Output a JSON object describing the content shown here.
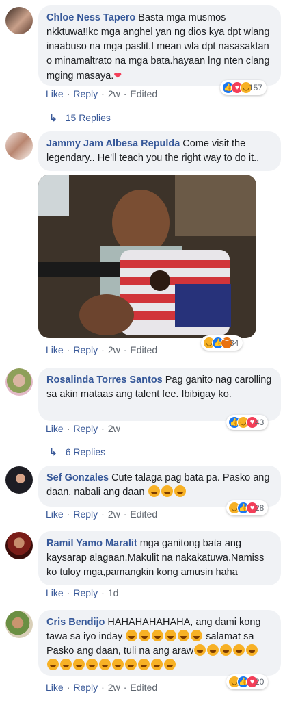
{
  "comments": [
    {
      "name": "Chloe Ness Tapero",
      "text": "Basta mga musmos nkktuwa!!kc mga anghel yan ng dios kya dpt wlang inaabuso na mga paslit.I mean wla dpt nasasaktan o minamaltrato na mga bata.hayaan lng nten clang mging masaya.",
      "like": "Like",
      "reply": "Reply",
      "time": "2w",
      "edited": "Edited",
      "reaction_count": "157",
      "reactions": [
        "like-icon",
        "love-icon",
        "haha-icon"
      ],
      "replies_label": "15 Replies"
    },
    {
      "name": "Jammy Jam Albesa Repulda",
      "text": "Come visit the legendary.. He'll teach you the right way to do it..",
      "like": "Like",
      "reply": "Reply",
      "time": "2w",
      "edited": "Edited",
      "reaction_count": "34",
      "reactions": [
        "haha-icon",
        "like-icon",
        "angry-icon"
      ]
    },
    {
      "name": "Rosalinda Torres Santos",
      "text": "Pag ganito nag carolling sa akin mataas ang talent fee. Ibibigay ko.",
      "like": "Like",
      "reply": "Reply",
      "time": "2w",
      "reaction_count": "43",
      "reactions": [
        "like-icon",
        "haha-icon",
        "love-icon"
      ],
      "replies_label": "6 Replies"
    },
    {
      "name": "Sef Gonzales",
      "text": "Cute talaga pag bata pa. Pasko ang daan, nabali ang daan",
      "like": "Like",
      "reply": "Reply",
      "time": "2w",
      "edited": "Edited",
      "reaction_count": "28",
      "reactions": [
        "haha-icon",
        "like-icon",
        "love-icon"
      ]
    },
    {
      "name": "Ramil Yamo Maralit",
      "text": "mga ganitong bata ang kaysarap alagaan.Makulit na nakakatuwa.Namiss ko tuloy mga,pamangkin kong amusin haha",
      "like": "Like",
      "reply": "Reply",
      "time": "1d"
    },
    {
      "name": "Cris Bendijo",
      "text_1": "HAHAHAHAHAHA, ang dami kong tawa sa iyo inday",
      "text_2": "salamat sa Pasko ang daan, tuli na ang araw",
      "like": "Like",
      "reply": "Reply",
      "time": "2w",
      "edited": "Edited",
      "reaction_count": "20",
      "reactions": [
        "haha-icon",
        "like-icon",
        "love-icon"
      ]
    }
  ],
  "colors": {
    "name": "#365899",
    "link": "#385898",
    "bubble": "#f0f2f5",
    "meta": "#606770"
  }
}
